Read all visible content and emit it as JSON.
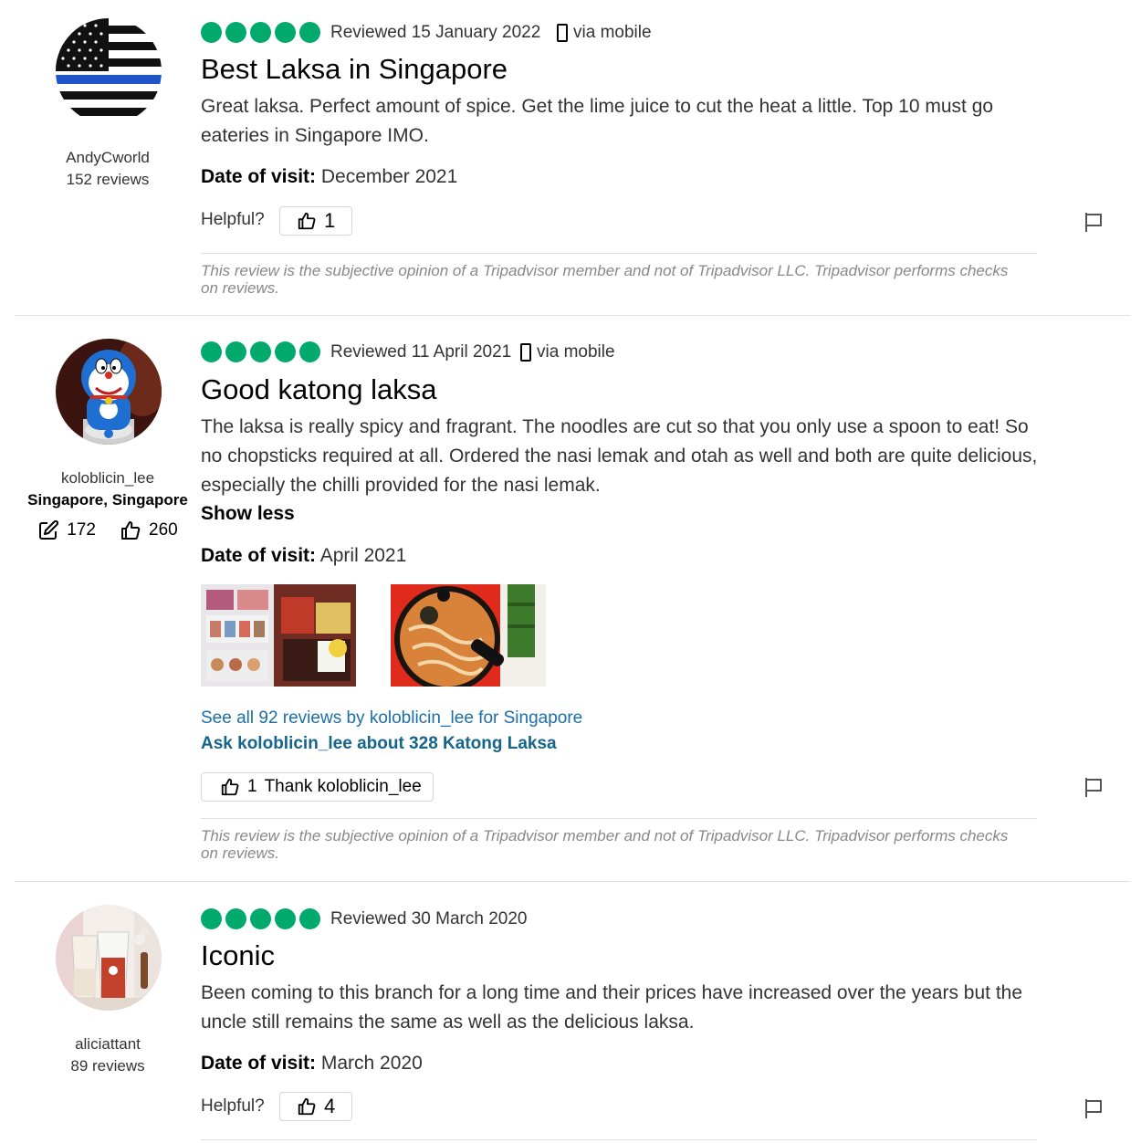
{
  "reviews": [
    {
      "user": {
        "name": "AndyCworld",
        "reviews": "152 reviews"
      },
      "rating": 5,
      "reviewed": "Reviewed 15 January 2022",
      "via": "via mobile",
      "title": "Best Laksa in Singapore",
      "body": "Great laksa. Perfect amount of spice. Get the lime juice to cut the heat a little. Top 10 must go eateries in Singapore IMO.",
      "date_label": "Date of visit:",
      "date_value": "December 2021",
      "helpful_label": "Helpful?",
      "helpful_count": "1",
      "disclaimer": "This review is the subjective opinion of a Tripadvisor member and not of Tripadvisor LLC. Tripadvisor performs checks on reviews."
    },
    {
      "user": {
        "name": "koloblicin_lee",
        "location": "Singapore, Singapore",
        "contributions": "172",
        "helpful_votes": "260"
      },
      "rating": 5,
      "reviewed": "Reviewed 11 April 2021",
      "via": "via mobile",
      "title": "Good katong laksa",
      "body": "The laksa is really spicy and fragrant. The noodles are cut so that you only use a spoon to eat! So no chopsticks required at all. Ordered the nasi lemak and otah as well and both are quite delicious, especially the chilli provided for the nasi lemak.",
      "show_less": "Show less",
      "date_label": "Date of visit:",
      "date_value": "April 2021",
      "see_all": "See all 92 reviews by koloblicin_lee for Singapore",
      "ask": "Ask koloblicin_lee about 328 Katong Laksa",
      "thank_count": "1",
      "thank_label": "Thank koloblicin_lee",
      "disclaimer": "This review is the subjective opinion of a Tripadvisor member and not of Tripadvisor LLC. Tripadvisor performs checks on reviews."
    },
    {
      "user": {
        "name": "aliciattant",
        "reviews": "89 reviews"
      },
      "rating": 5,
      "reviewed": "Reviewed 30 March 2020",
      "title": "Iconic",
      "body": "Been coming to this branch for a long time and their prices have increased over the years but the uncle still remains the same as well as the delicious laksa.",
      "date_label": "Date of visit:",
      "date_value": "March 2020",
      "helpful_label": "Helpful?",
      "helpful_count": "4"
    }
  ],
  "colors": {
    "rating": "#00aa6c",
    "link": "#1b6ea8",
    "divider": "#e0e0e0"
  },
  "icons": [
    "phone-icon",
    "thumbs-up-icon",
    "flag-icon",
    "edit-icon"
  ]
}
